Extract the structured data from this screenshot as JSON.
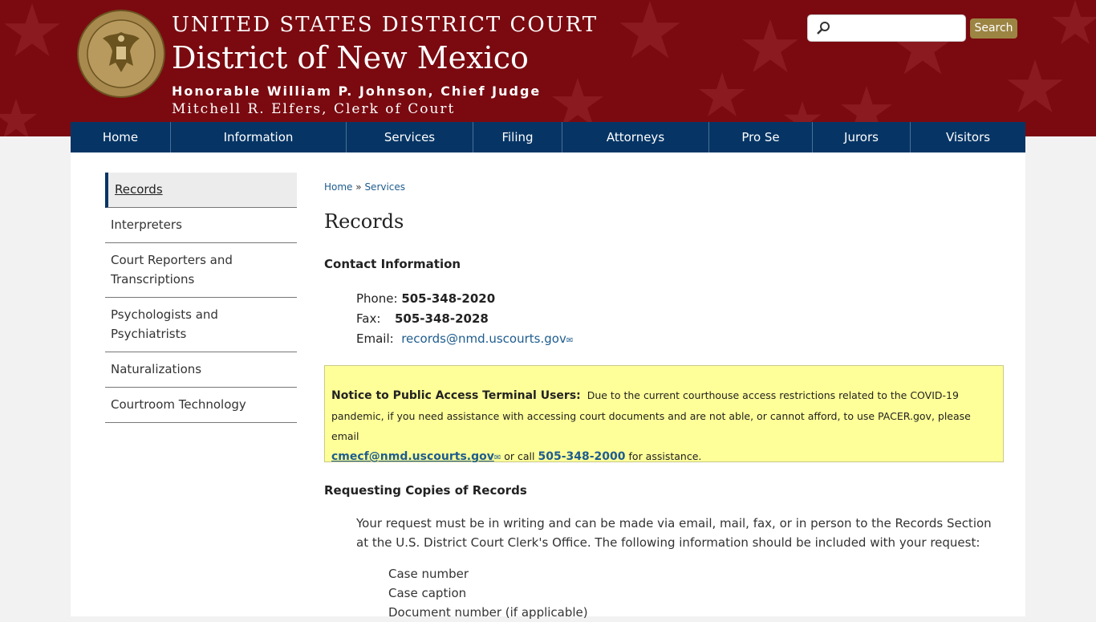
{
  "header": {
    "line1": "UNITED STATES DISTRICT COURT",
    "line2": "District of New Mexico",
    "line3": "Honorable William P. Johnson, Chief Judge",
    "line4": "Mitchell R. Elfers, Clerk of Court",
    "seal_icon": "court-seal-icon",
    "seal_text_top": "UNITED STATES DISTRICT COURT",
    "seal_text_bottom": "DISTRICT OF NEW MEXICO"
  },
  "search": {
    "placeholder": "",
    "button_label": "Search",
    "icon": "search-icon"
  },
  "nav": {
    "items": [
      "Home",
      "Information",
      "Services",
      "Filing",
      "Attorneys",
      "Pro Se",
      "Jurors",
      "Visitors"
    ]
  },
  "sidebar": {
    "items": [
      {
        "label": "Records"
      },
      {
        "label": "Interpreters"
      },
      {
        "label": "Court Reporters and Transcriptions"
      },
      {
        "label": "Psychologists and Psychiatrists"
      },
      {
        "label": "Naturalizations"
      },
      {
        "label": "Courtroom Technology"
      }
    ]
  },
  "breadcrumb": {
    "home": "Home",
    "sep": "»",
    "current": "Services"
  },
  "page": {
    "title": "Records",
    "contact_heading": "Contact Information",
    "phone_label": "Phone:",
    "phone_value": "505-348-2020",
    "fax_label": "Fax:",
    "fax_value": "505-348-2028",
    "email_label": "Email:",
    "email_value": "records@nmd.uscourts.gov"
  },
  "notice": {
    "lead": "Notice to Public Access Terminal Users:",
    "text1": "Due to the current courthouse access restrictions related to the COVID-19 pandemic, if you need assistance with accessing court documents and are not able, or cannot afford, to use PACER.gov, please email",
    "email": "cmecf@nmd.uscourts.gov",
    "text2": "or call",
    "phone": "505-348-2000",
    "text3": "for assistance."
  },
  "copies": {
    "heading": "Requesting Copies of Records",
    "paragraph": "Your request must be in writing and can be made via email, mail, fax, or in person to the Records Section at the U.S. District Court Clerk's Office.  The following information should be included with your request:",
    "items": [
      "Case number",
      "Case caption",
      "Document number (if applicable)"
    ]
  },
  "colors": {
    "header_bg": "#7a0a10",
    "nav_bg": "#063565",
    "search_button": "#9c8443",
    "notice_bg": "#ffff99",
    "link": "#1e5c8e"
  }
}
